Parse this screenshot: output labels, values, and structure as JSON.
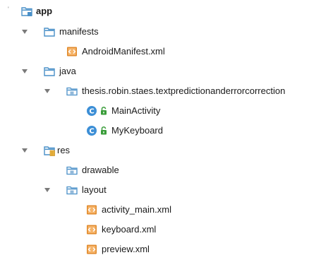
{
  "project_tree": {
    "app": {
      "label": "app",
      "icon": "module-folder-icon",
      "expanded": true
    },
    "manifests": {
      "label": "manifests",
      "icon": "folder-icon",
      "expanded": true
    },
    "android_manifest": {
      "label": "AndroidManifest.xml",
      "icon": "xml-file-icon"
    },
    "java": {
      "label": "java",
      "icon": "folder-icon",
      "expanded": true
    },
    "package": {
      "label": "thesis.robin.staes.textpredictionanderrorcorrection",
      "icon": "package-icon",
      "expanded": true
    },
    "main_activity": {
      "label": "MainActivity",
      "icon": "class-icon"
    },
    "my_keyboard": {
      "label": "MyKeyboard",
      "icon": "class-icon"
    },
    "res": {
      "label": "res",
      "icon": "resource-folder-icon",
      "expanded": true
    },
    "drawable": {
      "label": "drawable",
      "icon": "package-icon"
    },
    "layout": {
      "label": "layout",
      "icon": "package-icon",
      "expanded": true
    },
    "activity_main": {
      "label": "activity_main.xml",
      "icon": "xml-file-icon"
    },
    "keyboard": {
      "label": "keyboard.xml",
      "icon": "xml-file-icon"
    },
    "preview": {
      "label": "preview.xml",
      "icon": "xml-file-icon"
    }
  },
  "colors": {
    "folder_blue": "#4a90c8",
    "class_blue": "#3d8fd6",
    "lock_green": "#3a9d3a",
    "xml_orange": "#e08a2c",
    "arrow_gray": "#7a7a7a"
  }
}
